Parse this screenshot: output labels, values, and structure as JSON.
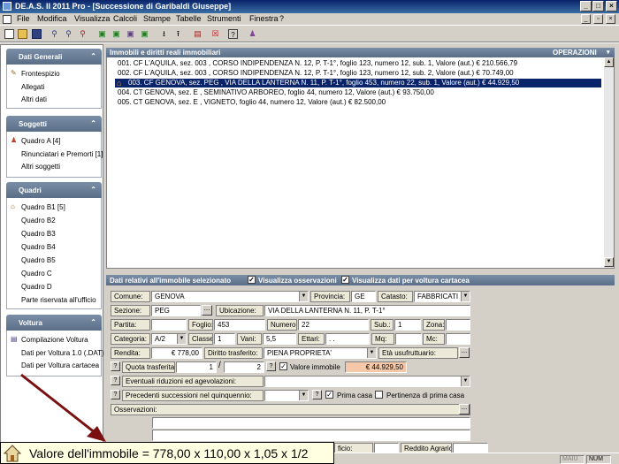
{
  "window": {
    "title": "DE.A.S. II 2011 Pro - [Successione di Garibaldi Giuseppe]"
  },
  "menu": [
    "File",
    "Modifica",
    "Visualizza",
    "Calcoli",
    "Stampe",
    "Tabelle",
    "Strumenti",
    "Finestra",
    "?"
  ],
  "sidebar": {
    "sections": [
      {
        "title": "Dati Generali",
        "items": [
          "Frontespizio",
          "Allegati",
          "Altri dati"
        ]
      },
      {
        "title": "Soggetti",
        "items": [
          "Quadro A [4]",
          "Rinunciatari e Premorti [1]",
          "Altri soggetti"
        ]
      },
      {
        "title": "Quadri",
        "items": [
          "Quadro B1 [5]",
          "Quadro B2",
          "Quadro B3",
          "Quadro B4",
          "Quadro B5",
          "Quadro C",
          "Quadro D",
          "Parte riservata all'ufficio"
        ]
      },
      {
        "title": "Voltura",
        "items": [
          "Compilazione Voltura",
          "Dati per Voltura 1.0 (.DAT)",
          "Dati per Voltura cartacea"
        ]
      }
    ]
  },
  "list": {
    "title": "Immobili e diritti reali immobiliari",
    "operations": "OPERAZIONI",
    "rows": [
      "001. CF L'AQUILA, sez. 003 , CORSO INDIPENDENZA N. 12, P. T-1°, foglio 123, numero 12, sub. 1, Valore (aut.) € 210.566,79",
      "002. CF L'AQUILA, sez. 003 , CORSO INDIPENDENZA N. 12, P. T-1°, foglio 123, numero 12, sub. 2, Valore (aut.) € 70.749,00",
      "003. CF GENOVA, sez. PEG , VIA DELLA LANTERNA N. 11, P. T-1°, foglio 453, numero 22, sub. 1, Valore (aut.) € 44.929,50",
      "004. CT GENOVA, sez. E , SEMINATIVO ARBOREO, foglio 44, numero 12, Valore (aut.) € 93.750,00",
      "005. CT GENOVA, sez. E , VIGNETO, foglio 44, numero 12, Valore (aut.) € 82.500,00"
    ]
  },
  "form": {
    "title": "Dati relativi all'immobile selezionato",
    "vis_oss": "Visualizza osservazioni",
    "vis_voltura": "Visualizza dati per voltura cartacea",
    "labels": {
      "comune": "Comune:",
      "provincia": "Provincia:",
      "catasto": "Catasto:",
      "sezione": "Sezione:",
      "ubicazione": "Ubicazione:",
      "partita": "Partita:",
      "foglio": "Foglio:",
      "numero": "Numero:",
      "sub": "Sub.:",
      "zona": "Zona:",
      "categoria": "Categoria:",
      "classe": "Classe:",
      "vani": "Vani:",
      "ettari": "Ettari:",
      "mq": "Mq:",
      "mc": "Mc:",
      "rendita": "Rendita:",
      "diritto": "Diritto trasferito:",
      "eta": "Età usufruttuario:",
      "quota": "Quota trasferita:",
      "valore_immobile": "Valore immobile",
      "riduzioni": "Eventuali riduzioni ed agevolazioni:",
      "precedenti": "Precedenti successioni nel quinquennio:",
      "prima_casa": "Prima casa",
      "pertinenza": "Pertinenza di prima casa",
      "osservazioni": "Osservazioni:",
      "dominicale": "ficio:",
      "agrario": "Reddito Agrario:"
    },
    "values": {
      "comune": "GENOVA",
      "provincia": "GE",
      "catasto": "FABBRICATI",
      "sezione": "PEG",
      "ubicazione": "VIA DELLA LANTERNA N. 11, P. T-1°",
      "foglio": "453",
      "numero": "22",
      "sub": "1",
      "categoria": "A/2",
      "classe": "1",
      "vani": "5,5",
      "ettari": ". .",
      "rendita": "€ 778,00",
      "diritto": "PIENA PROPRIETA'",
      "quota_num": "1",
      "quota_den": "2",
      "valore": "€ 44.929,50"
    }
  },
  "tooltip": {
    "text": "Valore dell'immobile = 778,00 x 110,00 x 1,05 x 1/2"
  },
  "status": {
    "maiu": "MAIU",
    "num": "NUM"
  },
  "colors": {
    "accent": "#0a246a",
    "tooltip_bg": "#ffffe1",
    "valore_bg": "#f4c8a8",
    "arrow": "#7a1010"
  }
}
